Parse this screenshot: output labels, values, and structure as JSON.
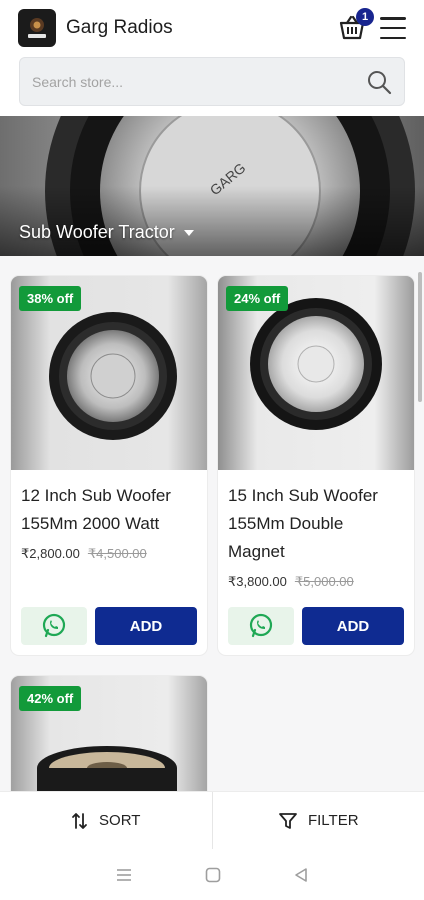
{
  "header": {
    "brand": "Garg Radios",
    "cart_count": "1",
    "icons": {
      "cart": "cart-icon",
      "menu": "hamburger-icon",
      "logo": "store-logo"
    }
  },
  "search": {
    "placeholder": "Search store..."
  },
  "hero": {
    "title": "Sub Woofer Tractor"
  },
  "products": [
    {
      "discount": "38% off",
      "title": "12 Inch Sub Woofer 155Mm 2000 Watt",
      "price": "₹2,800.00",
      "mrp": "₹4,500.00",
      "add_label": "ADD"
    },
    {
      "discount": "24% off",
      "title": "15 Inch Sub Woofer 155Mm Double Magnet",
      "price": "₹3,800.00",
      "mrp": "₹5,000.00",
      "add_label": "ADD"
    },
    {
      "discount": "42% off"
    }
  ],
  "bottom_bar": {
    "sort_label": "SORT",
    "filter_label": "FILTER"
  },
  "colors": {
    "accent": "#0f2b91",
    "discount_green": "#129a3a",
    "whatsapp_green": "#1fa855"
  }
}
